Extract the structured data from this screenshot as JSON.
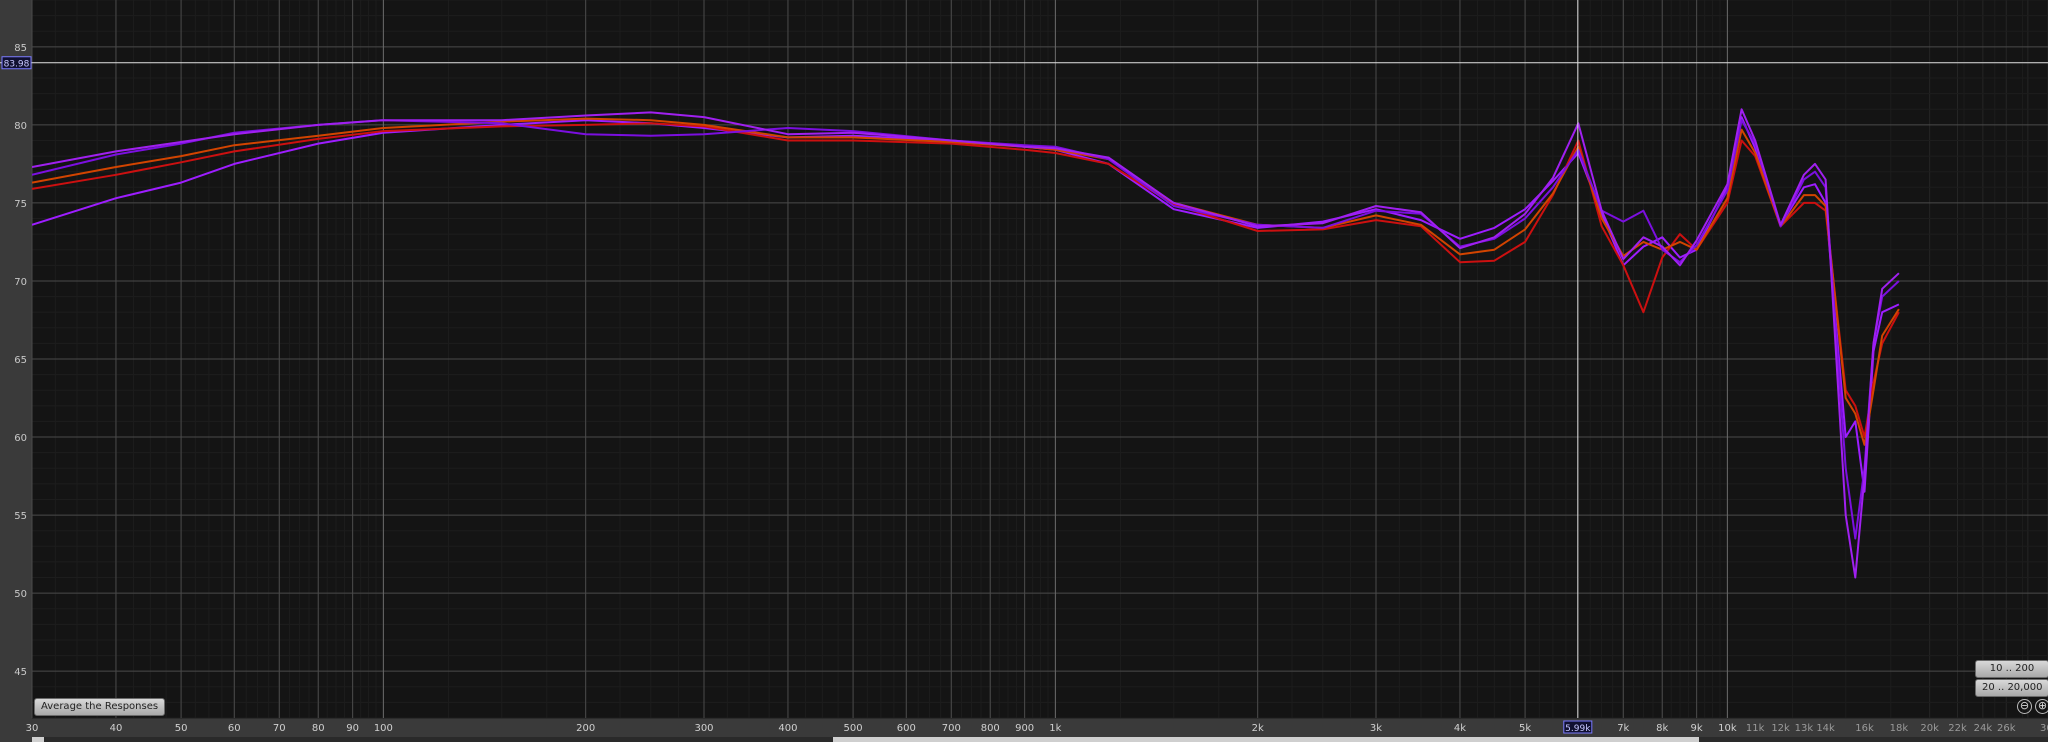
{
  "chart_data": {
    "type": "line",
    "xscale": "log",
    "xlim": [
      30,
      30000
    ],
    "ylim": [
      42,
      88
    ],
    "grid": true,
    "x_tick_labels": [
      {
        "v": 30,
        "t": "30"
      },
      {
        "v": 40,
        "t": "40"
      },
      {
        "v": 50,
        "t": "50"
      },
      {
        "v": 60,
        "t": "60"
      },
      {
        "v": 70,
        "t": "70"
      },
      {
        "v": 80,
        "t": "80"
      },
      {
        "v": 90,
        "t": "90"
      },
      {
        "v": 100,
        "t": "100"
      },
      {
        "v": 200,
        "t": "200"
      },
      {
        "v": 300,
        "t": "300"
      },
      {
        "v": 400,
        "t": "400"
      },
      {
        "v": 500,
        "t": "500"
      },
      {
        "v": 600,
        "t": "600"
      },
      {
        "v": 700,
        "t": "700"
      },
      {
        "v": 800,
        "t": "800"
      },
      {
        "v": 900,
        "t": "900"
      },
      {
        "v": 1000,
        "t": "1k"
      },
      {
        "v": 2000,
        "t": "2k"
      },
      {
        "v": 3000,
        "t": "3k"
      },
      {
        "v": 4000,
        "t": "4k"
      },
      {
        "v": 5000,
        "t": "5k"
      },
      {
        "v": 7000,
        "t": "7k"
      },
      {
        "v": 8000,
        "t": "8k"
      },
      {
        "v": 9000,
        "t": "9k"
      },
      {
        "v": 10000,
        "t": "10k"
      },
      {
        "v": 11000,
        "t": "11k",
        "minor": true
      },
      {
        "v": 12000,
        "t": "12k",
        "minor": true
      },
      {
        "v": 13000,
        "t": "13k",
        "minor": true
      },
      {
        "v": 14000,
        "t": "14k",
        "minor": true
      },
      {
        "v": 16000,
        "t": "16k",
        "minor": true
      },
      {
        "v": 18000,
        "t": "18k",
        "minor": true
      },
      {
        "v": 20000,
        "t": "20k",
        "minor": true
      },
      {
        "v": 22000,
        "t": "22k",
        "minor": true
      },
      {
        "v": 24000,
        "t": "24k",
        "minor": true
      },
      {
        "v": 26000,
        "t": "26k",
        "minor": true
      },
      {
        "v": 30000,
        "t": "30,",
        "minor": true
      }
    ],
    "y_ticks": [
      45,
      50,
      55,
      60,
      65,
      70,
      75,
      80,
      85
    ],
    "y_tick_labels": [
      "45",
      "50",
      "55",
      "60",
      "65",
      "70",
      "75",
      "80",
      "85"
    ],
    "cursor": {
      "x": 5990,
      "y": 83.98,
      "x_label": "5.99k",
      "y_label": "83.98"
    },
    "series": [
      {
        "color": "#9d1dff",
        "points": [
          [
            30,
            73.6
          ],
          [
            40,
            75.3
          ],
          [
            50,
            76.3
          ],
          [
            60,
            77.5
          ],
          [
            80,
            78.8
          ],
          [
            100,
            79.5
          ],
          [
            150,
            80.0
          ],
          [
            200,
            80.3
          ],
          [
            250,
            80.1
          ],
          [
            300,
            79.8
          ],
          [
            400,
            79.2
          ],
          [
            500,
            79.3
          ],
          [
            700,
            79.0
          ],
          [
            900,
            78.6
          ],
          [
            1000,
            78.4
          ],
          [
            1200,
            77.5
          ],
          [
            1500,
            74.6
          ],
          [
            2000,
            73.4
          ],
          [
            2500,
            73.8
          ],
          [
            3000,
            74.6
          ],
          [
            3500,
            73.9
          ],
          [
            4000,
            72.7
          ],
          [
            4500,
            73.4
          ],
          [
            5000,
            74.6
          ],
          [
            5500,
            76.4
          ],
          [
            6000,
            78.2
          ],
          [
            6500,
            74.3
          ],
          [
            7000,
            71.0
          ],
          [
            7500,
            72.2
          ],
          [
            8000,
            72.8
          ],
          [
            8500,
            71.5
          ],
          [
            9000,
            72.0
          ],
          [
            10000,
            76.0
          ],
          [
            10500,
            80.5
          ],
          [
            11000,
            78.5
          ],
          [
            12000,
            73.6
          ],
          [
            13000,
            76.0
          ],
          [
            13500,
            76.2
          ],
          [
            14000,
            75.0
          ],
          [
            15000,
            60.0
          ],
          [
            15500,
            61.0
          ],
          [
            16000,
            56.5
          ],
          [
            16500,
            65.5
          ],
          [
            17000,
            68.0
          ],
          [
            18000,
            68.5
          ]
        ]
      },
      {
        "color": "#cc1010",
        "points": [
          [
            30,
            75.9
          ],
          [
            40,
            76.8
          ],
          [
            50,
            77.6
          ],
          [
            60,
            78.3
          ],
          [
            80,
            79.1
          ],
          [
            100,
            79.6
          ],
          [
            150,
            79.9
          ],
          [
            200,
            80.0
          ],
          [
            250,
            80.1
          ],
          [
            300,
            79.9
          ],
          [
            400,
            79.0
          ],
          [
            500,
            79.0
          ],
          [
            700,
            78.8
          ],
          [
            900,
            78.4
          ],
          [
            1000,
            78.2
          ],
          [
            1200,
            77.5
          ],
          [
            1500,
            74.9
          ],
          [
            2000,
            73.2
          ],
          [
            2500,
            73.3
          ],
          [
            3000,
            73.9
          ],
          [
            3500,
            73.5
          ],
          [
            4000,
            71.2
          ],
          [
            4500,
            71.3
          ],
          [
            5000,
            72.5
          ],
          [
            5500,
            75.5
          ],
          [
            6000,
            79.0
          ],
          [
            6500,
            73.5
          ],
          [
            7000,
            71.0
          ],
          [
            7500,
            68.0
          ],
          [
            8000,
            71.5
          ],
          [
            8500,
            73.0
          ],
          [
            9000,
            72.0
          ],
          [
            10000,
            75.0
          ],
          [
            10500,
            79.0
          ],
          [
            11000,
            78.0
          ],
          [
            12000,
            73.5
          ],
          [
            13000,
            75.0
          ],
          [
            13500,
            75.0
          ],
          [
            14000,
            74.5
          ],
          [
            15000,
            63.0
          ],
          [
            15500,
            62.0
          ],
          [
            16000,
            60.0
          ],
          [
            16500,
            63.5
          ],
          [
            17000,
            66.0
          ],
          [
            18000,
            68.0
          ]
        ]
      },
      {
        "color": "#d24400",
        "points": [
          [
            30,
            76.3
          ],
          [
            40,
            77.3
          ],
          [
            50,
            78.0
          ],
          [
            60,
            78.7
          ],
          [
            80,
            79.3
          ],
          [
            100,
            79.8
          ],
          [
            150,
            80.2
          ],
          [
            200,
            80.4
          ],
          [
            250,
            80.3
          ],
          [
            300,
            80.0
          ],
          [
            400,
            79.2
          ],
          [
            500,
            79.2
          ],
          [
            700,
            78.9
          ],
          [
            900,
            78.6
          ],
          [
            1000,
            78.4
          ],
          [
            1200,
            77.8
          ],
          [
            1500,
            75.0
          ],
          [
            2000,
            73.6
          ],
          [
            2500,
            73.4
          ],
          [
            3000,
            74.2
          ],
          [
            3500,
            73.6
          ],
          [
            4000,
            71.7
          ],
          [
            4500,
            72.0
          ],
          [
            5000,
            73.3
          ],
          [
            5500,
            75.6
          ],
          [
            6000,
            78.6
          ],
          [
            6500,
            74.0
          ],
          [
            7000,
            71.6
          ],
          [
            7500,
            72.5
          ],
          [
            8000,
            72.0
          ],
          [
            8500,
            72.5
          ],
          [
            9000,
            72.0
          ],
          [
            10000,
            75.3
          ],
          [
            10500,
            79.7
          ],
          [
            11000,
            78.2
          ],
          [
            12000,
            73.5
          ],
          [
            13000,
            75.5
          ],
          [
            13500,
            75.5
          ],
          [
            14000,
            74.8
          ],
          [
            15000,
            62.5
          ],
          [
            15500,
            61.5
          ],
          [
            16000,
            59.5
          ],
          [
            16500,
            63.0
          ],
          [
            17000,
            66.5
          ],
          [
            18000,
            68.2
          ]
        ]
      },
      {
        "color": "#7b0fe0",
        "points": [
          [
            30,
            76.8
          ],
          [
            40,
            78.1
          ],
          [
            50,
            78.8
          ],
          [
            60,
            79.5
          ],
          [
            80,
            80.0
          ],
          [
            100,
            80.3
          ],
          [
            150,
            80.1
          ],
          [
            200,
            79.4
          ],
          [
            250,
            79.3
          ],
          [
            300,
            79.4
          ],
          [
            400,
            79.8
          ],
          [
            500,
            79.6
          ],
          [
            700,
            79.0
          ],
          [
            900,
            78.7
          ],
          [
            1000,
            78.6
          ],
          [
            1200,
            77.8
          ],
          [
            1500,
            74.8
          ],
          [
            2000,
            73.6
          ],
          [
            2500,
            73.4
          ],
          [
            3000,
            74.5
          ],
          [
            3500,
            74.3
          ],
          [
            4000,
            72.2
          ],
          [
            4500,
            72.7
          ],
          [
            5000,
            74.0
          ],
          [
            5500,
            76.0
          ],
          [
            6000,
            78.4
          ],
          [
            6500,
            74.5
          ],
          [
            7000,
            73.8
          ],
          [
            7500,
            74.5
          ],
          [
            8000,
            72.0
          ],
          [
            8500,
            71.2
          ],
          [
            9000,
            72.3
          ],
          [
            10000,
            75.8
          ],
          [
            10500,
            80.3
          ],
          [
            11000,
            78.8
          ],
          [
            12000,
            73.5
          ],
          [
            13000,
            76.5
          ],
          [
            13500,
            77.0
          ],
          [
            14000,
            76.0
          ],
          [
            15000,
            58.0
          ],
          [
            15500,
            53.5
          ],
          [
            16000,
            58.0
          ],
          [
            16500,
            66.0
          ],
          [
            17000,
            69.0
          ],
          [
            18000,
            70.0
          ]
        ]
      },
      {
        "color": "#a020f0",
        "points": [
          [
            30,
            77.3
          ],
          [
            40,
            78.3
          ],
          [
            50,
            78.9
          ],
          [
            60,
            79.4
          ],
          [
            80,
            80.0
          ],
          [
            100,
            80.3
          ],
          [
            150,
            80.3
          ],
          [
            200,
            80.6
          ],
          [
            250,
            80.8
          ],
          [
            300,
            80.5
          ],
          [
            400,
            79.4
          ],
          [
            500,
            79.5
          ],
          [
            700,
            79.0
          ],
          [
            900,
            78.6
          ],
          [
            1000,
            78.5
          ],
          [
            1200,
            77.9
          ],
          [
            1500,
            75.0
          ],
          [
            2000,
            73.5
          ],
          [
            2500,
            73.7
          ],
          [
            3000,
            74.8
          ],
          [
            3500,
            74.4
          ],
          [
            4000,
            72.1
          ],
          [
            4500,
            72.8
          ],
          [
            5000,
            74.3
          ],
          [
            5500,
            76.6
          ],
          [
            6000,
            80.1
          ],
          [
            6500,
            74.5
          ],
          [
            7000,
            71.4
          ],
          [
            7500,
            72.8
          ],
          [
            8000,
            72.2
          ],
          [
            8500,
            71.0
          ],
          [
            9000,
            72.6
          ],
          [
            10000,
            76.2
          ],
          [
            10500,
            81.0
          ],
          [
            11000,
            79.0
          ],
          [
            12000,
            73.6
          ],
          [
            13000,
            76.8
          ],
          [
            13500,
            77.5
          ],
          [
            14000,
            76.5
          ],
          [
            15000,
            55.0
          ],
          [
            15500,
            51.0
          ],
          [
            16000,
            57.5
          ],
          [
            16500,
            66.0
          ],
          [
            17000,
            69.5
          ],
          [
            18000,
            70.5
          ]
        ]
      }
    ]
  },
  "buttons": {
    "average": "Average the Responses",
    "range_a": "10 .. 200",
    "range_b": "20 .. 20,000"
  },
  "zoom": {
    "out": "⊖",
    "in": "⊕"
  },
  "colors": {
    "plot_bg": "#141414",
    "grid_major": "#4a4a4a",
    "grid_minor": "#262626",
    "axis_panel": "#3a3a3a",
    "cursor": "#e0e0e0"
  }
}
